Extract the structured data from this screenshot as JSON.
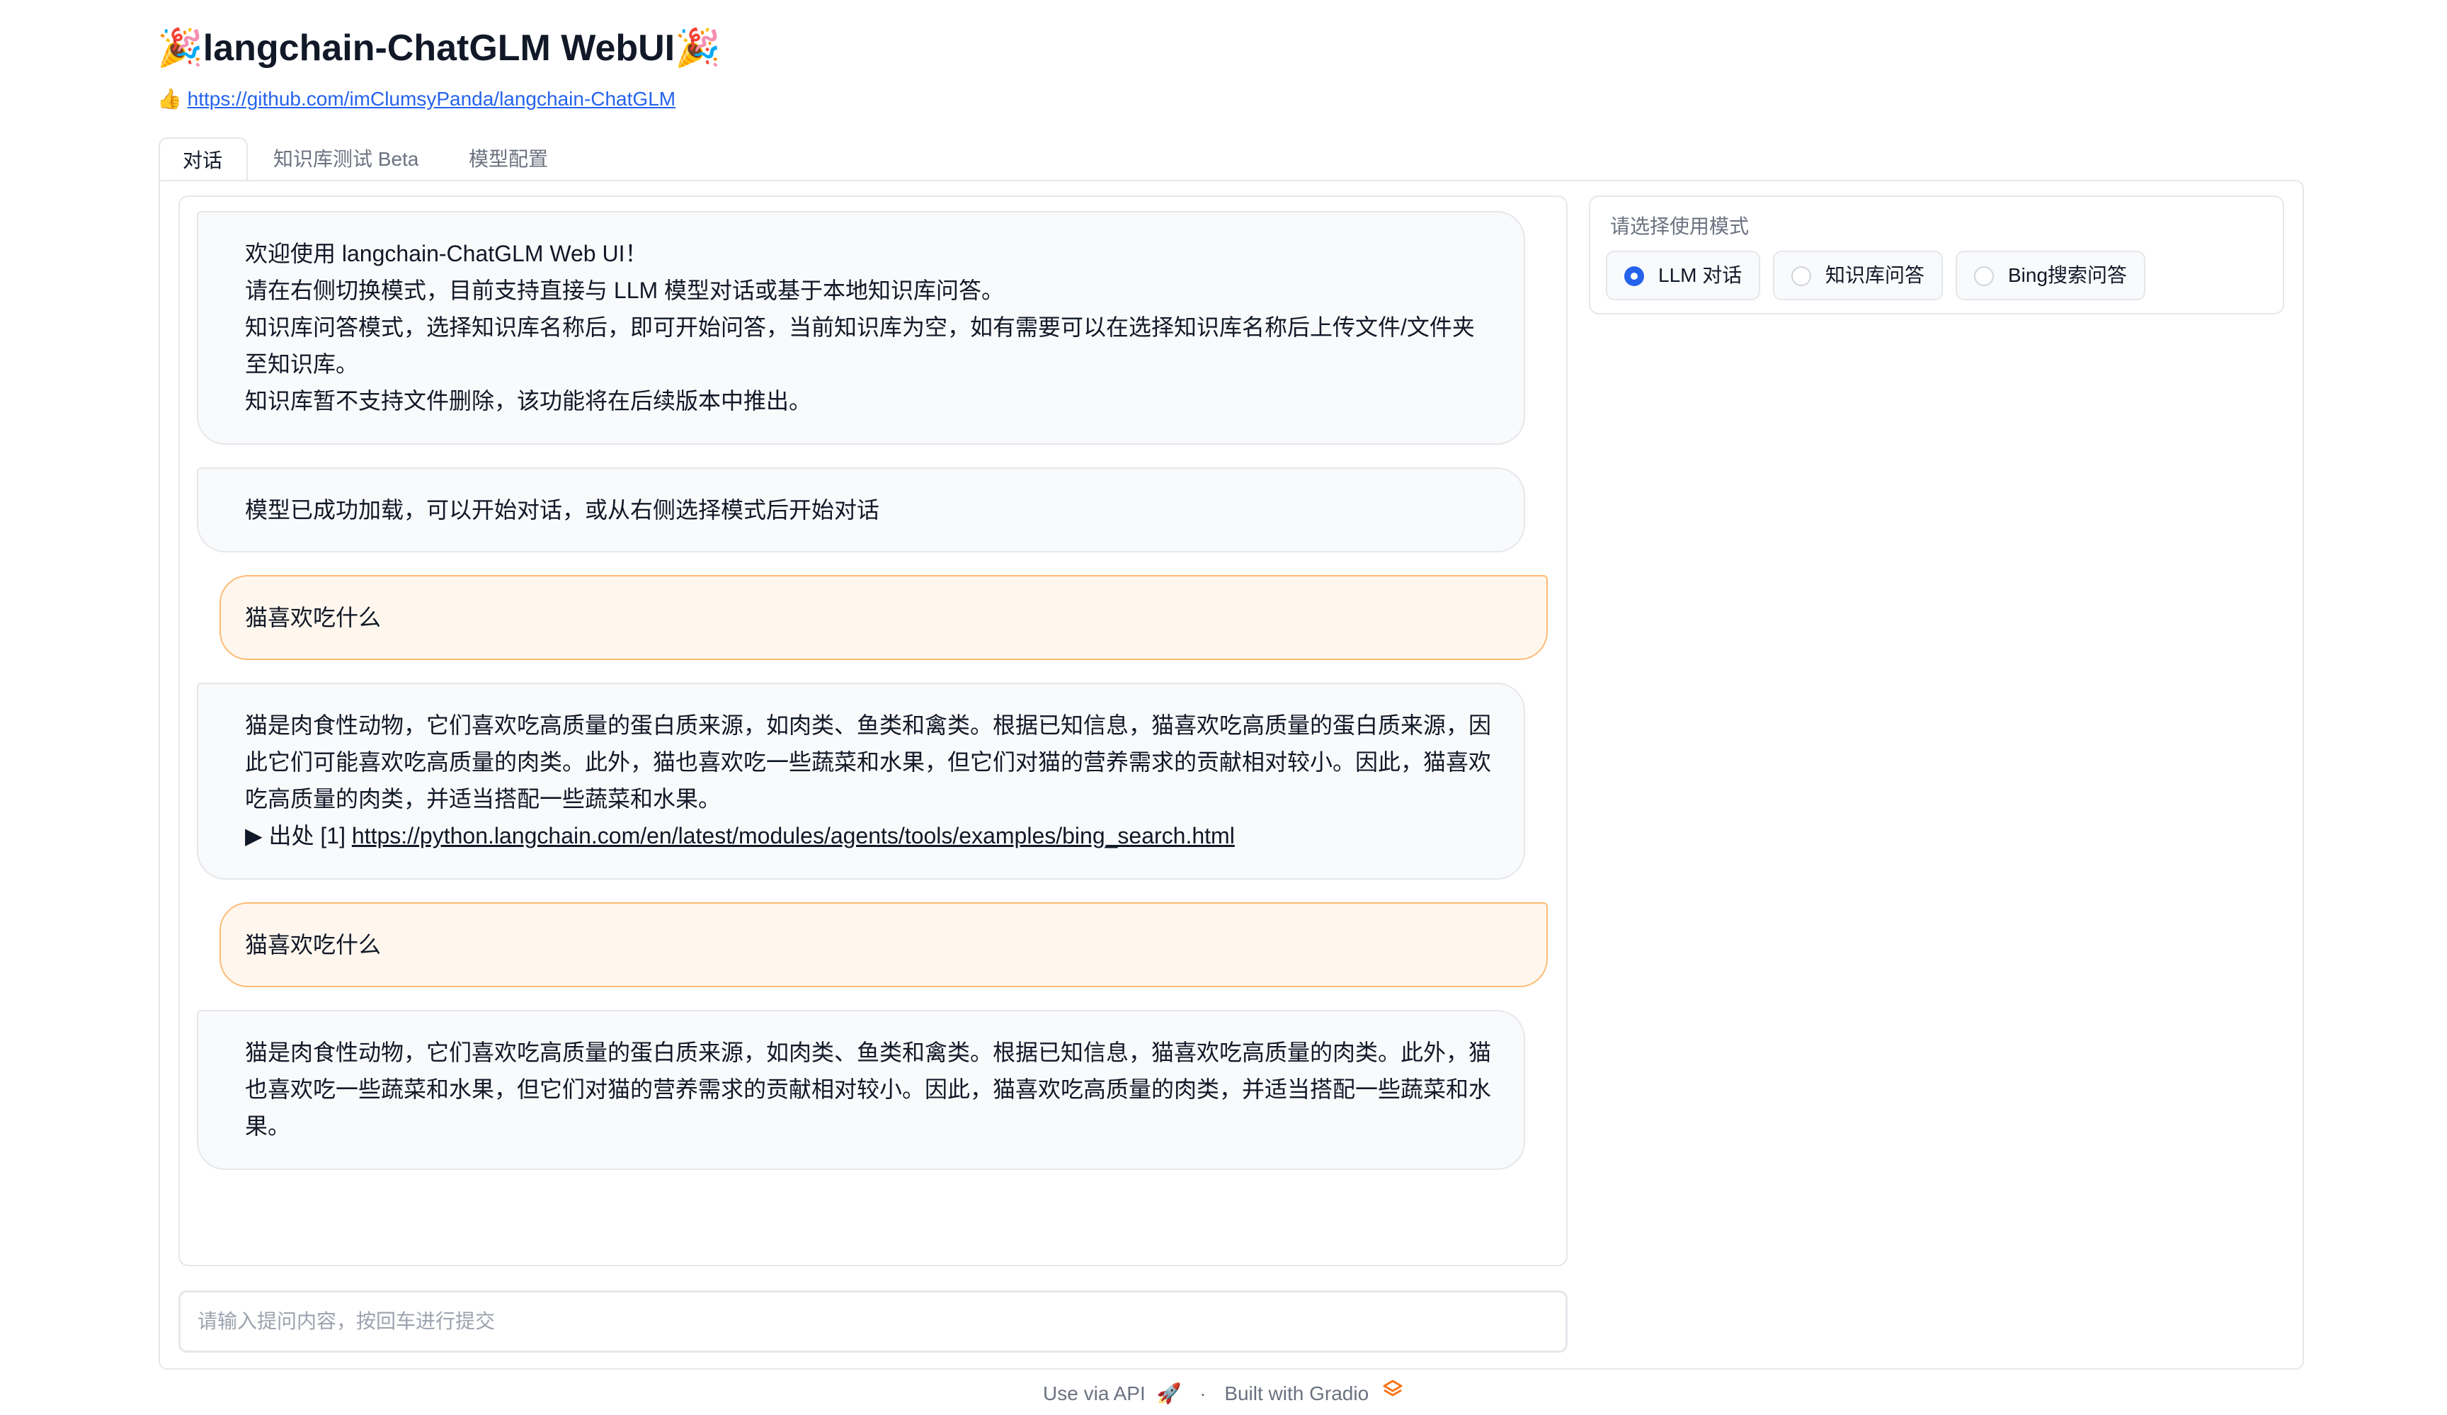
{
  "header": {
    "title_emoji_left": "🎉",
    "title": "langchain-ChatGLM WebUI",
    "title_emoji_right": "🎉",
    "thumb": "👍",
    "repo_url": "https://github.com/imClumsyPanda/langchain-ChatGLM"
  },
  "tabs": [
    {
      "label": "对话",
      "active": true
    },
    {
      "label": "知识库测试 Beta",
      "active": false
    },
    {
      "label": "模型配置",
      "active": false
    }
  ],
  "chat": {
    "messages": [
      {
        "role": "bot",
        "lines": [
          "欢迎使用 langchain-ChatGLM Web UI！",
          "请在右侧切换模式，目前支持直接与 LLM 模型对话或基于本地知识库问答。",
          "知识库问答模式，选择知识库名称后，即可开始问答，当前知识库为空，如有需要可以在选择知识库名称后上传文件/文件夹",
          "至知识库。",
          "知识库暂不支持文件删除，该功能将在后续版本中推出。"
        ]
      },
      {
        "role": "bot",
        "lines": [
          "模型已成功加载，可以开始对话，或从右侧选择模式后开始对话"
        ]
      },
      {
        "role": "user",
        "lines": [
          "猫喜欢吃什么"
        ]
      },
      {
        "role": "bot",
        "lines": [
          "猫是肉食性动物，它们喜欢吃高质量的蛋白质来源，如肉类、鱼类和禽类。根据已知信息，猫喜欢吃高质量的蛋白质来源，因",
          "此它们可能喜欢吃高质量的肉类。此外，猫也喜欢吃一些蔬菜和水果，但它们对猫的营养需求的贡献相对较小。因此，猫喜欢",
          "吃高质量的肉类，并适当搭配一些蔬菜和水果。"
        ],
        "source_prefix": "▶ 出处 [1]",
        "source_url": "https://python.langchain.com/en/latest/modules/agents/tools/examples/bing_search.html"
      },
      {
        "role": "user",
        "lines": [
          "猫喜欢吃什么"
        ]
      },
      {
        "role": "bot",
        "lines": [
          "猫是肉食性动物，它们喜欢吃高质量的蛋白质来源，如肉类、鱼类和禽类。根据已知信息，猫喜欢吃高质量的肉类。此外，猫",
          "也喜欢吃一些蔬菜和水果，但它们对猫的营养需求的贡献相对较小。因此，猫喜欢吃高质量的肉类，并适当搭配一些蔬菜和水",
          "果。"
        ]
      }
    ]
  },
  "input": {
    "placeholder": "请输入提问内容，按回车进行提交",
    "value": ""
  },
  "mode": {
    "label": "请选择使用模式",
    "options": [
      {
        "label": "LLM 对话",
        "checked": true
      },
      {
        "label": "知识库问答",
        "checked": false
      },
      {
        "label": "Bing搜索问答",
        "checked": false
      }
    ]
  },
  "footer": {
    "api": "Use via API",
    "api_icon": "🚀",
    "separator": "·",
    "built": "Built with Gradio",
    "gradio_icon": "gradio-logo-icon"
  },
  "colors": {
    "accent": "#2563eb",
    "user_bubble": "#fff7ed",
    "user_border": "#fdba74",
    "bot_bubble": "#f9fafb"
  }
}
